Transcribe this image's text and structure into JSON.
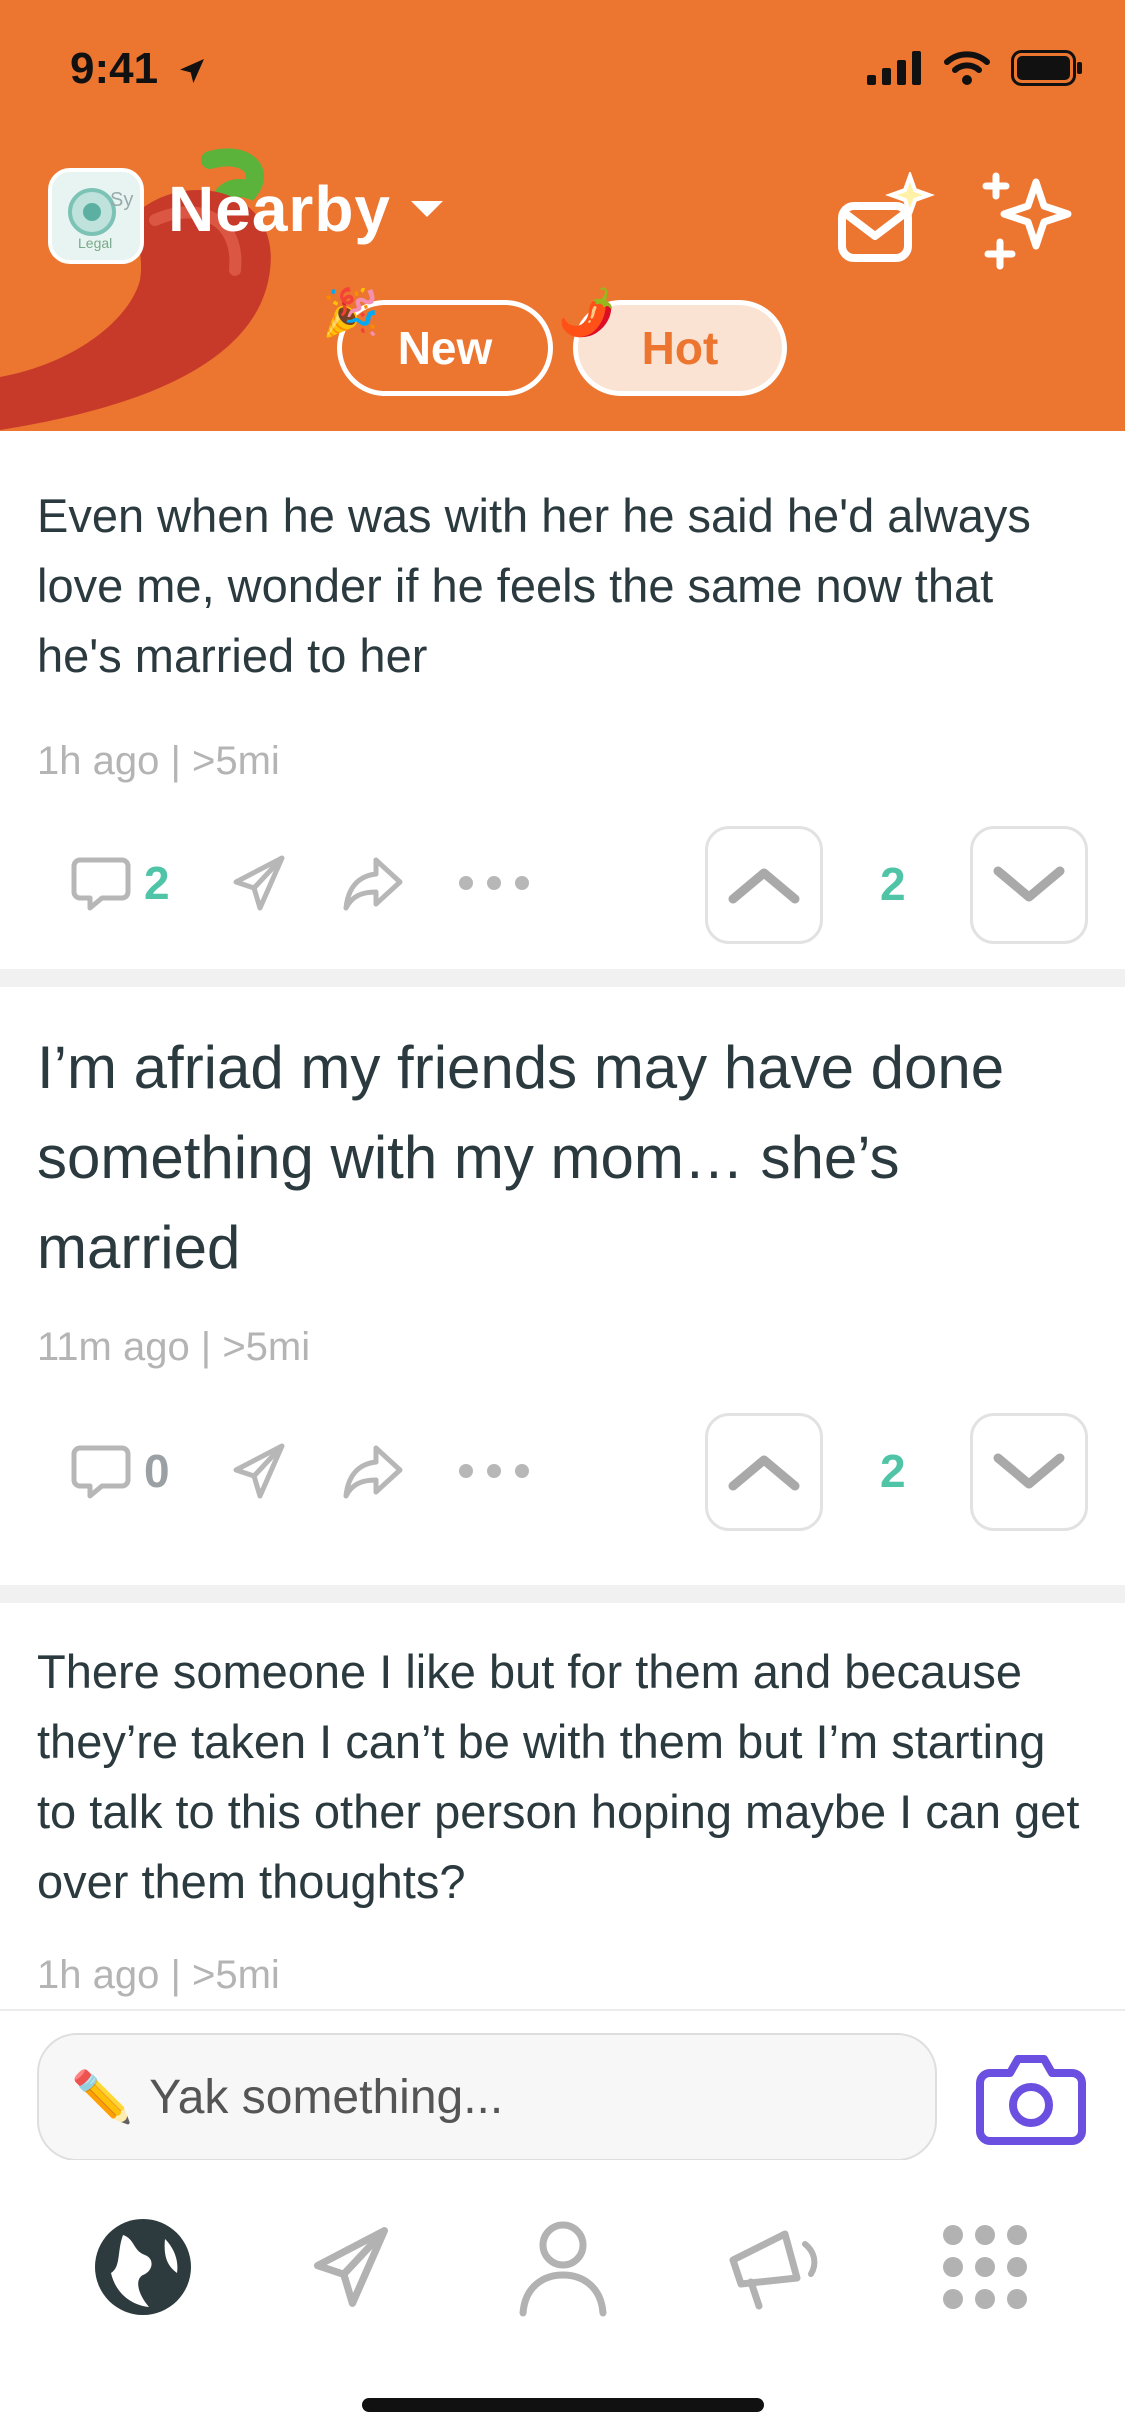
{
  "status_bar": {
    "time": "9:41"
  },
  "header": {
    "location_label": "Nearby",
    "avatar_text_top": "Sy",
    "avatar_text_bottom": "Legal",
    "tabs": [
      {
        "label": "New",
        "emoji": "🎉",
        "active": false
      },
      {
        "label": "Hot",
        "emoji": "🌶️",
        "active": true
      }
    ],
    "colors": {
      "header_bg": "#ec7530",
      "active_tab_bg": "#fbe3d3",
      "active_tab_text": "#ec7530"
    }
  },
  "posts": [
    {
      "text": "Even when he was with her he said he'd always love me, wonder if he feels the same now that he's married to her",
      "meta": "1h ago | >5mi",
      "comments": "2",
      "votes": "2"
    },
    {
      "text": "I’m afriad my friends may have done something with my mom… she’s married",
      "meta": "11m ago | >5mi",
      "comments": "0",
      "votes": "2"
    },
    {
      "text": "There someone I like but for them and because they’re taken I can’t be with them but I’m starting to talk to this other person hoping maybe I can get over them thoughts?",
      "meta": "1h ago | >5mi"
    }
  ],
  "composer": {
    "placeholder": "Yak something...",
    "emoji": "✏️"
  },
  "tab_bar": {
    "items": [
      "globe-icon",
      "send-icon",
      "profile-icon",
      "megaphone-icon",
      "grid-icon"
    ]
  },
  "colors": {
    "accent_green": "#4fc4a6",
    "camera_purple": "#6a4fe0"
  }
}
